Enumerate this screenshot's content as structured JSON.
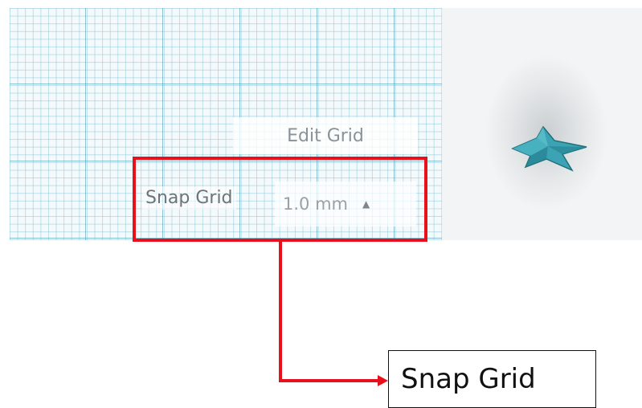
{
  "workplane": {
    "edit_grid_label": "Edit Grid",
    "snap_grid_label": "Snap Grid",
    "snap_grid_value": "1.0 mm",
    "caret_icon": "caret-up-icon",
    "view_icon": "star-shape-icon",
    "grid_color": "#3c96b4",
    "star_color": "#3ba3b4"
  },
  "annotation": {
    "callout_label": "Snap Grid",
    "highlight_color": "#e8101a"
  }
}
